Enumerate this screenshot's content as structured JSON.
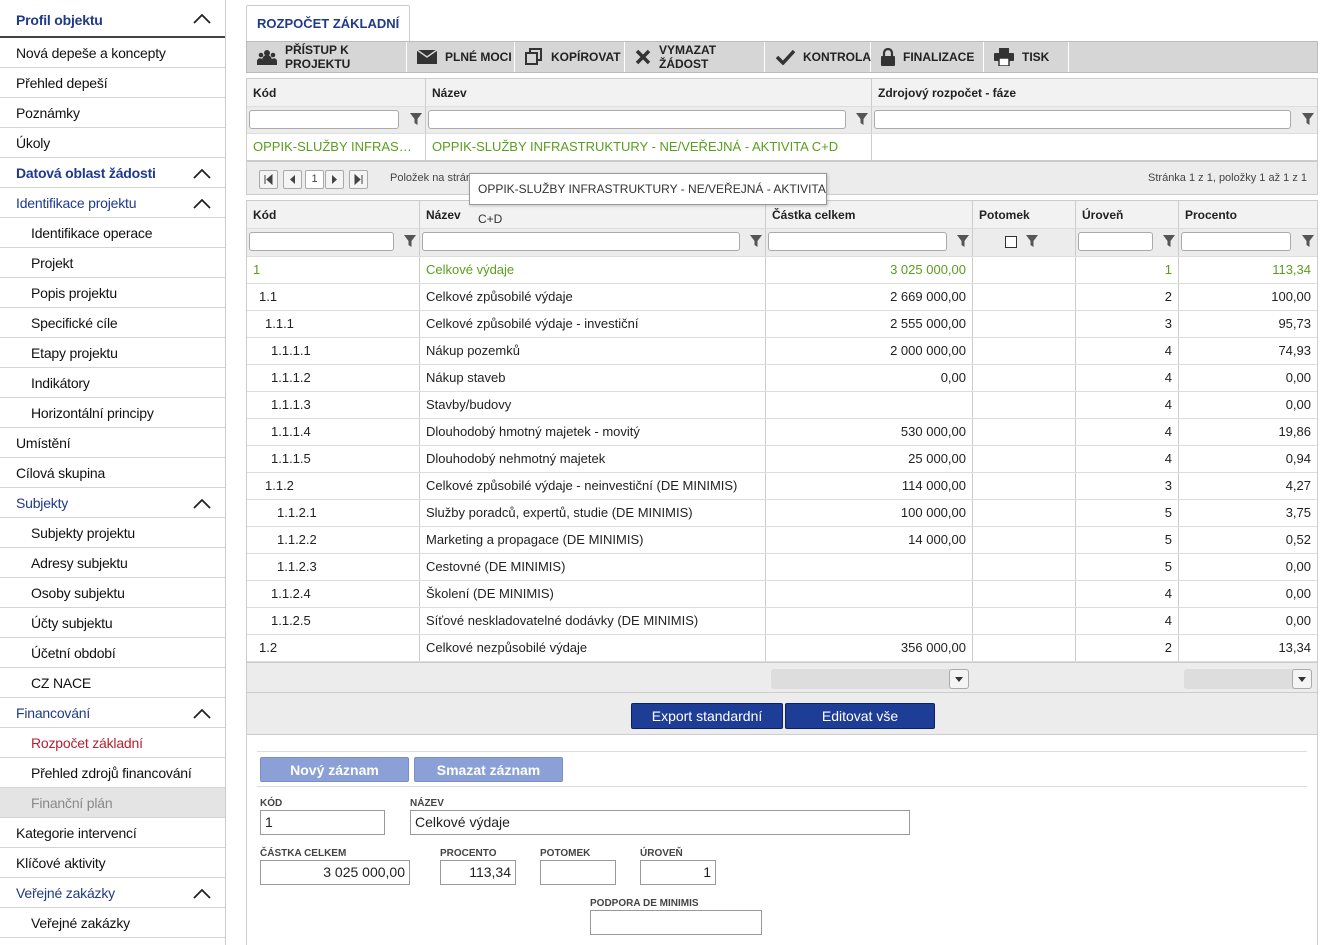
{
  "sidebar": {
    "items": [
      {
        "label": "Profil objektu",
        "kind": "head",
        "chev": true
      },
      {
        "label": "Nová depeše a koncepty",
        "kind": ""
      },
      {
        "label": "Přehled depeší",
        "kind": ""
      },
      {
        "label": "Poznámky",
        "kind": ""
      },
      {
        "label": "Úkoly",
        "kind": ""
      },
      {
        "label": "Datová oblast žádosti",
        "kind": "sect bold",
        "chev": true
      },
      {
        "label": "Identifikace projektu",
        "kind": "sect",
        "chev": true
      },
      {
        "label": "Identifikace operace",
        "kind": "sub"
      },
      {
        "label": "Projekt",
        "kind": "sub"
      },
      {
        "label": "Popis projektu",
        "kind": "sub"
      },
      {
        "label": "Specifické cíle",
        "kind": "sub"
      },
      {
        "label": "Etapy projektu",
        "kind": "sub"
      },
      {
        "label": "Indikátory",
        "kind": "sub"
      },
      {
        "label": "Horizontální principy",
        "kind": "sub"
      },
      {
        "label": "Umístění",
        "kind": ""
      },
      {
        "label": "Cílová skupina",
        "kind": ""
      },
      {
        "label": "Subjekty",
        "kind": "sect",
        "chev": true
      },
      {
        "label": "Subjekty projektu",
        "kind": "sub"
      },
      {
        "label": "Adresy subjektu",
        "kind": "sub"
      },
      {
        "label": "Osoby subjektu",
        "kind": "sub"
      },
      {
        "label": "Účty subjektu",
        "kind": "sub"
      },
      {
        "label": "Účetní období",
        "kind": "sub"
      },
      {
        "label": "CZ NACE",
        "kind": "sub"
      },
      {
        "label": "Financování",
        "kind": "sect",
        "chev": true
      },
      {
        "label": "Rozpočet základní",
        "kind": "sub active"
      },
      {
        "label": "Přehled zdrojů financování",
        "kind": "sub"
      },
      {
        "label": "Finanční plán",
        "kind": "sub disabled"
      },
      {
        "label": "Kategorie intervencí",
        "kind": ""
      },
      {
        "label": "Klíčové aktivity",
        "kind": ""
      },
      {
        "label": "Veřejné zakázky",
        "kind": "sect",
        "chev": true
      },
      {
        "label": "Veřejné zakázky",
        "kind": "sub"
      }
    ]
  },
  "tab": {
    "label": "ROZPOČET ZÁKLADNÍ"
  },
  "toolbar": {
    "buttons": [
      {
        "label": "PŘÍSTUP K PROJEKTU",
        "icon": "people-icon"
      },
      {
        "label": "PLNÉ MOCI",
        "icon": "envelope-icon"
      },
      {
        "label": "KOPÍROVAT",
        "icon": "copy-icon"
      },
      {
        "label": "VYMAZAT ŽÁDOST",
        "icon": "delete-icon"
      },
      {
        "label": "KONTROLA",
        "icon": "check-icon"
      },
      {
        "label": "FINALIZACE",
        "icon": "lock-icon"
      },
      {
        "label": "TISK",
        "icon": "print-icon"
      }
    ]
  },
  "grid1": {
    "headers": [
      "Kód",
      "Název",
      "Zdrojový rozpočet - fáze"
    ],
    "row": {
      "kod": "OPPIK-SLUŽBY INFRASTRUKTURY - NE/VEŘEJNÁ - AKTIVITA C+D",
      "nazev": "OPPIK-SLUŽBY INFRASTRUKTURY - NE/VEŘEJNÁ - AKTIVITA C+D",
      "zdroj": ""
    }
  },
  "pager": {
    "page": "1",
    "items_label": "Položek na strán",
    "status": "Stránka 1 z 1, položky 1 až 1 z 1"
  },
  "tooltip": "OPPIK-SLUŽBY INFRASTRUKTURY - NE/VEŘEJNÁ - AKTIVITA C+D",
  "grid2": {
    "headers": [
      "Kód",
      "Název",
      "Částka celkem",
      "Potomek",
      "Úroveň",
      "Procento"
    ],
    "rows": [
      {
        "kod": "1",
        "nazev": "Celkové výdaje",
        "castka": "3 025 000,00",
        "uroven": "1",
        "procento": "113,34",
        "indent": 0,
        "green": true
      },
      {
        "kod": "1.1",
        "nazev": "Celkové způsobilé výdaje",
        "castka": "2 669 000,00",
        "uroven": "2",
        "procento": "100,00",
        "indent": 1
      },
      {
        "kod": "1.1.1",
        "nazev": "Celkové způsobilé výdaje - investiční",
        "castka": "2 555 000,00",
        "uroven": "3",
        "procento": "95,73",
        "indent": 2
      },
      {
        "kod": "1.1.1.1",
        "nazev": "Nákup pozemků",
        "castka": "2 000 000,00",
        "uroven": "4",
        "procento": "74,93",
        "indent": 3
      },
      {
        "kod": "1.1.1.2",
        "nazev": "Nákup staveb",
        "castka": "0,00",
        "uroven": "4",
        "procento": "0,00",
        "indent": 3
      },
      {
        "kod": "1.1.1.3",
        "nazev": "Stavby/budovy",
        "castka": "",
        "uroven": "4",
        "procento": "0,00",
        "indent": 3
      },
      {
        "kod": "1.1.1.4",
        "nazev": "Dlouhodobý hmotný majetek - movitý",
        "castka": "530 000,00",
        "uroven": "4",
        "procento": "19,86",
        "indent": 3
      },
      {
        "kod": "1.1.1.5",
        "nazev": "Dlouhodobý nehmotný majetek",
        "castka": "25 000,00",
        "uroven": "4",
        "procento": "0,94",
        "indent": 3
      },
      {
        "kod": "1.1.2",
        "nazev": "Celkové způsobilé výdaje - neinvestiční (DE MINIMIS)",
        "castka": "114 000,00",
        "uroven": "3",
        "procento": "4,27",
        "indent": 2
      },
      {
        "kod": "1.1.2.1",
        "nazev": "Služby poradců, expertů, studie (DE MINIMIS)",
        "castka": "100 000,00",
        "uroven": "5",
        "procento": "3,75",
        "indent": 4
      },
      {
        "kod": "1.1.2.2",
        "nazev": "Marketing a propagace (DE MINIMIS)",
        "castka": "14 000,00",
        "uroven": "5",
        "procento": "0,52",
        "indent": 4
      },
      {
        "kod": "1.1.2.3",
        "nazev": "Cestovné (DE MINIMIS)",
        "castka": "",
        "uroven": "5",
        "procento": "0,00",
        "indent": 4
      },
      {
        "kod": "1.1.2.4",
        "nazev": "Školení (DE MINIMIS)",
        "castka": "",
        "uroven": "4",
        "procento": "0,00",
        "indent": 3
      },
      {
        "kod": "1.1.2.5",
        "nazev": "Síťové neskladovatelné dodávky (DE MINIMIS)",
        "castka": "",
        "uroven": "4",
        "procento": "0,00",
        "indent": 3
      },
      {
        "kod": "1.2",
        "nazev": "Celkové nezpůsobilé výdaje",
        "castka": "356 000,00",
        "uroven": "2",
        "procento": "13,34",
        "indent": 1
      }
    ]
  },
  "actions": {
    "export": "Export standardní",
    "edit_all": "Editovat vše"
  },
  "form": {
    "new": "Nový záznam",
    "delete": "Smazat záznam",
    "kod_label": "KÓD",
    "kod": "1",
    "nazev_label": "NÁZEV",
    "nazev": "Celkové výdaje",
    "castka_label": "ČÁSTKA CELKEM",
    "castka": "3 025 000,00",
    "procento_label": "PROCENTO",
    "procento": "113,34",
    "potomek_label": "POTOMEK",
    "potomek": "",
    "uroven_label": "ÚROVEŇ",
    "uroven": "1",
    "podpora_label": "PODPORA DE MINIMIS",
    "podpora": ""
  },
  "colors": {
    "accent": "#1e3d96",
    "green": "#5a9e1d",
    "active": "#b81e2e"
  }
}
